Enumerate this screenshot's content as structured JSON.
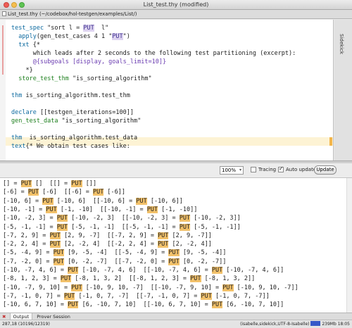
{
  "window": {
    "title": "List_test.thy (modified)"
  },
  "file_tab": {
    "label": "List_test.thy (~/codebox/hol-testgen/examples/List/)"
  },
  "editor": {
    "lines": [
      "test_spec \"sort l = PUT  l\"",
      "  apply(gen_test_cases 4 1 \"PUT\")",
      "  txt {*",
      "      which leads after 2 seconds to the following test partitioning (excerpt):",
      "      @{subgoals [display, goals_limit=10]}",
      "    *}",
      "  store_test_thm \"is_sorting_algorithm\"",
      "",
      "thm is_sorting_algorithm.test_thm",
      "",
      "declare [[testgen_iterations=100]]",
      "gen_test_data \"is_sorting_algorithm\"",
      "",
      "thm  is_sorting_algorithm.test_data",
      "text{* We obtain test cases like:"
    ]
  },
  "sidebar": {
    "label": "Sidekick"
  },
  "output_toolbar": {
    "zoom_value": "100%",
    "tracing_label": "Tracing",
    "auto_update_label": "Auto update",
    "update_button": "Update"
  },
  "output": {
    "lines": [
      "[] = PUT []  [[] = PUT []]",
      "[-6] = PUT [-6]  [[-6] = PUT [-6]]",
      "[-10, 6] = PUT [-10, 6]  [[-10, 6] = PUT [-10, 6]]",
      "[-10, -1] = PUT [-1, -10]  [[-10, -1] = PUT [-1, -10]]",
      "[-10, -2, 3] = PUT [-10, -2, 3]  [[-10, -2, 3] = PUT [-10, -2, 3]]",
      "[-5, -1, -1] = PUT [-5, -1, -1]  [[-5, -1, -1] = PUT [-5, -1, -1]]",
      "[-7, 2, 9] = PUT [2, 9, -7]  [[-7, 2, 9] = PUT [2, 9, -7]]",
      "[-2, 2, 4] = PUT [2, -2, 4]  [[-2, 2, 4] = PUT [2, -2, 4]]",
      "[-5, -4, 9] = PUT [9, -5, -4]  [[-5, -4, 9] = PUT [9, -5, -4]]",
      "[-7, -2, 0] = PUT [0, -2, -7]  [[-7, -2, 0] = PUT [0, -2, -7]]",
      "[-10, -7, 4, 6] = PUT [-10, -7, 4, 6]  [[-10, -7, 4, 6] = PUT [-10, -7, 4, 6]]",
      "[-8, 1, 2, 3] = PUT [-8, 1, 3, 2]  [[-8, 1, 2, 3] = PUT [-8, 1, 3, 2]]",
      "[-10, -7, 9, 10] = PUT [-10, 9, 10, -7]  [[-10, -7, 9, 10] = PUT [-10, 9, 10, -7]]",
      "[-7, -1, 0, 7] = PUT [-1, 0, 7, -7]  [[-7, -1, 0, 7] = PUT [-1, 0, 7, -7]]",
      "[-10, 6, 7, 10] = PUT [6, -10, 7, 10]  [[-10, 6, 7, 10] = PUT [6, -10, 7, 10]]"
    ]
  },
  "dock": {
    "tabs": [
      "Output",
      "Prover Session"
    ]
  },
  "status": {
    "position": "287,18 (10196/12319)",
    "mode": "(isabelle,sidekick,UTF-8-Isabelle)",
    "memory": "239Mb 18:05"
  }
}
